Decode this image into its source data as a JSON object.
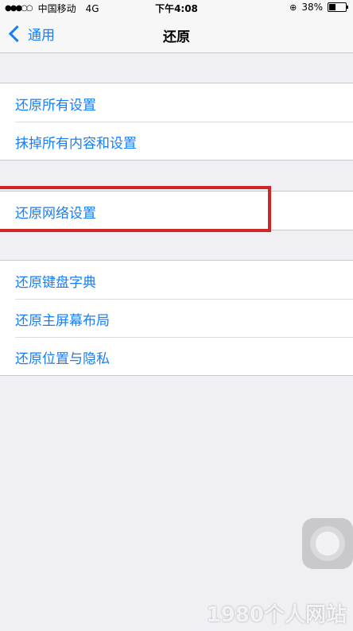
{
  "status_bar": {
    "signal": "●●●○○",
    "carrier": "中国移动",
    "network": "4G",
    "time": "下午4:08",
    "battery_percent": "38%",
    "battery_level": 0.38
  },
  "nav": {
    "back_label": "通用",
    "title": "还原"
  },
  "groups": [
    {
      "items": [
        {
          "label": "还原所有设置"
        },
        {
          "label": "抹掉所有内容和设置"
        }
      ]
    },
    {
      "items": [
        {
          "label": "还原网络设置"
        }
      ]
    },
    {
      "items": [
        {
          "label": "还原键盘字典"
        },
        {
          "label": "还原主屏幕布局"
        },
        {
          "label": "还原位置与隐私"
        }
      ]
    }
  ],
  "watermark": "1980个人网站",
  "colors": {
    "accent": "#157efb",
    "background": "#efeff4",
    "highlight": "#d0262a"
  },
  "icons": {
    "back": "chevron-left-icon",
    "orientation_lock": "orientation-lock-icon",
    "battery": "battery-icon"
  }
}
